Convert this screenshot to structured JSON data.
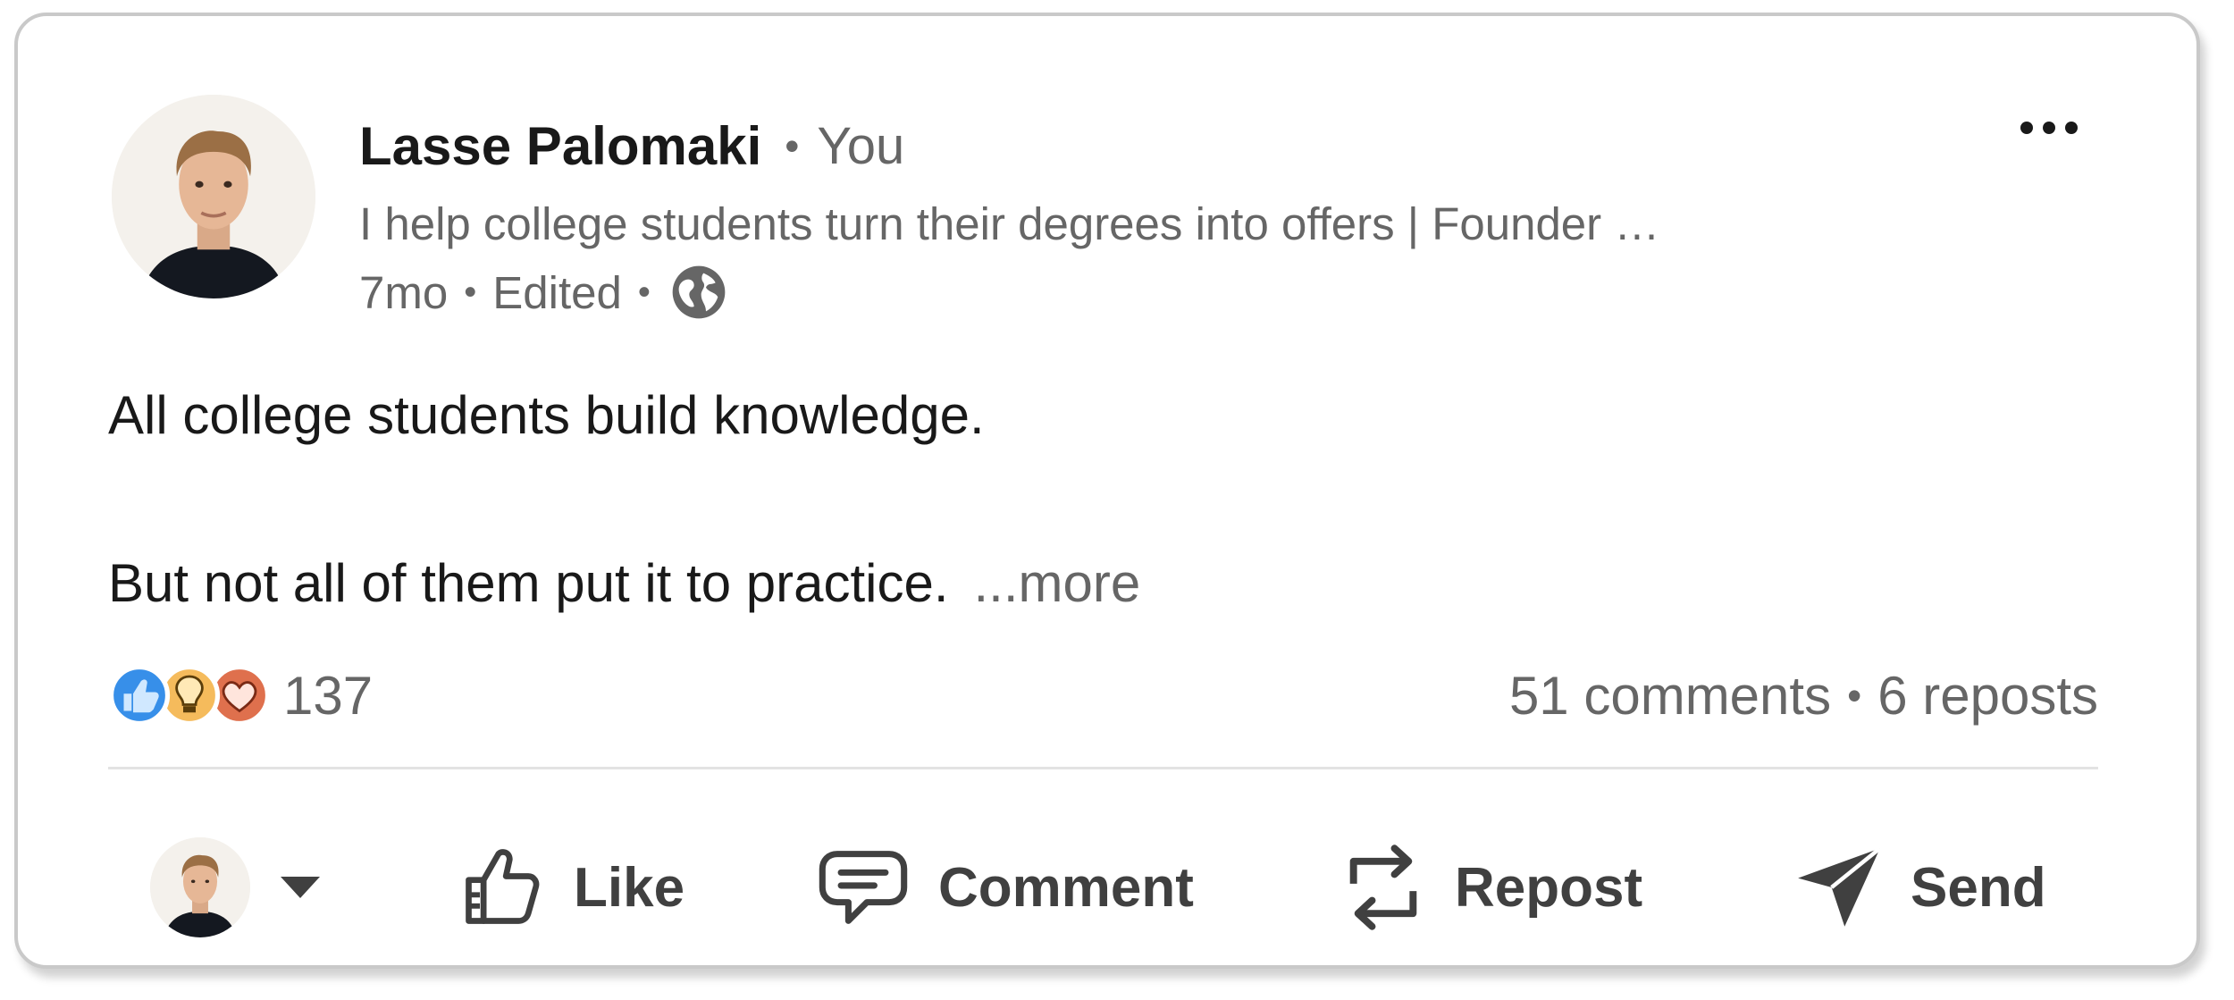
{
  "post": {
    "author_name": "Lasse Palomaki",
    "author_relation": "You",
    "headline": "I help college students turn their degrees into offers | Founder …",
    "age": "7mo",
    "edited": "Edited",
    "visibility_icon": "globe-icon",
    "text_line1": "All college students build knowledge.",
    "text_line2": "But not all of them put it to practice.",
    "see_more": "...more",
    "reaction_icons": [
      "like-icon",
      "insightful-icon",
      "love-icon"
    ],
    "reaction_count": "137",
    "comments": "51 comments",
    "reposts": "6 reposts"
  },
  "actions": {
    "reactor_switch_icon": "chevron-down-icon",
    "like": "Like",
    "comment": "Comment",
    "repost": "Repost",
    "send": "Send"
  },
  "colors": {
    "text_primary": "#191919",
    "text_secondary": "#666666",
    "action_text": "#404040",
    "like_blue": "#378fe9",
    "insightful_yellow": "#f5bb5c",
    "love_red": "#df704d"
  }
}
